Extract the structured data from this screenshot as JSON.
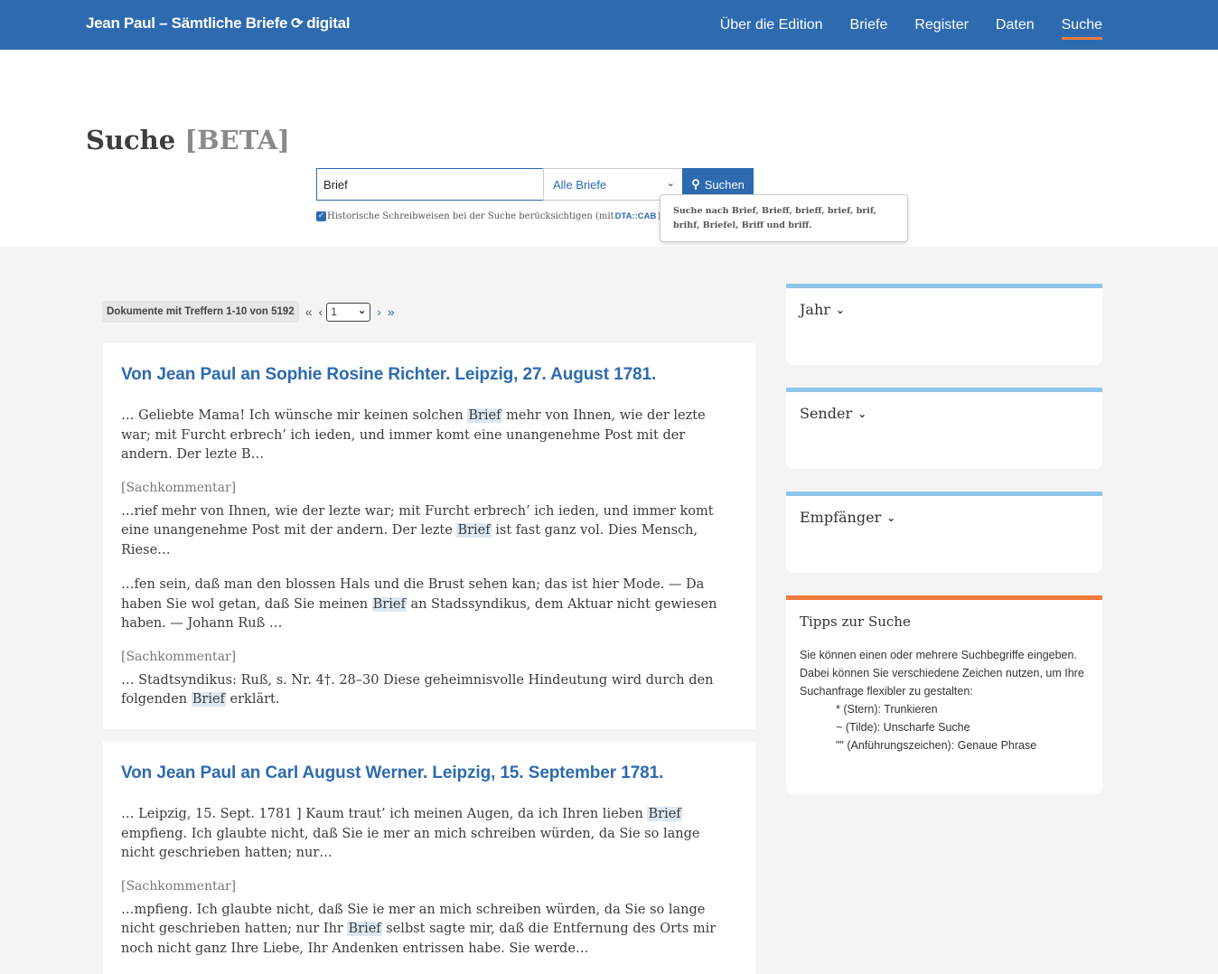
{
  "header": {
    "brand_left": "Jean Paul – Sämtliche Briefe",
    "brand_right": "digital",
    "nav": [
      "Über die Edition",
      "Briefe",
      "Register",
      "Daten",
      "Suche"
    ],
    "active_nav": "Suche",
    "accent_color": "#2d6ab0",
    "active_underline_color": "#f07a3c"
  },
  "page": {
    "title": "Suche",
    "title_suffix": "[BETA]"
  },
  "search": {
    "query": "Brief",
    "scope": "Alle Briefe",
    "button_label": "Suchen",
    "historic_label": "Historische Schreibweisen bei der Suche berücksichtigen (mit ",
    "historic_link": "DTA::CAB",
    "historic_close": ")",
    "historic_checked": true,
    "tooltip": "Suche nach Brief, Brieff, brieff, brief, brif, brihf, Briefel, Briff und briff."
  },
  "pager": {
    "count_label": "Dokumente mit Treffern 1-10 von 5192",
    "current_page": "1"
  },
  "results": [
    {
      "title": "Von Jean Paul an Sophie Rosine Richter. Leipzig, 27. August 1781.",
      "blocks": [
        {
          "type": "snippet",
          "before": "… Geliebte Mama! Ich wünsche mir keinen solchen ",
          "hit": "Brief",
          "after": " mehr von Ihnen, wie der lezte war; mit Furcht erbrech’ ich ieden, und immer komt eine unangenehme Post mit der andern. Der lezte B…"
        },
        {
          "type": "kommentar",
          "label": "[Sachkommentar]"
        },
        {
          "type": "snippet",
          "before": "…rief mehr von Ihnen, wie der lezte war; mit Furcht erbrech’ ich ieden, und immer komt eine unangenehme Post mit der andern. Der lezte ",
          "hit": "Brief",
          "after": " ist fast ganz vol. Dies Mensch, Riese…"
        },
        {
          "type": "snippet",
          "before": "…fen sein, daß man den blossen Hals und die Brust sehen kan; das ist hier Mode. — Da haben Sie wol getan, daß Sie meinen ",
          "hit": "Brief",
          "after": " an Stadssyndikus, dem Aktuar nicht gewiesen haben. — Johann Ruß …"
        },
        {
          "type": "kommentar",
          "label": "[Sachkommentar]"
        },
        {
          "type": "snippet",
          "before": "… Stadtsyndikus: Ruß, s. Nr. 4†. 28–30 Diese geheimnisvolle Hindeutung wird durch den folgenden ",
          "hit": "Brief",
          "after": " erklärt."
        }
      ]
    },
    {
      "title": "Von Jean Paul an Carl August Werner. Leipzig, 15. September 1781.",
      "blocks": [
        {
          "type": "snippet",
          "before": "… Leipzig, 15. Sept. 1781 ] Kaum traut’ ich meinen Augen, da ich Ihren lieben ",
          "hit": "Brief",
          "after": " empfieng. Ich glaubte nicht, daß Sie ie mer an mich schreiben würden, da Sie so lange nicht geschrieben hatten; nur…"
        },
        {
          "type": "kommentar",
          "label": "[Sachkommentar]"
        },
        {
          "type": "snippet",
          "before": "…mpfieng. Ich glaubte nicht, daß Sie ie mer an mich schreiben würden, da Sie so lange nicht geschrieben hatten; nur Ihr ",
          "hit": "Brief",
          "after": " selbst sagte mir, daß die Entfernung des Orts mir noch nicht ganz Ihre Liebe, Ihr Andenken entrissen habe. Sie werde…"
        }
      ]
    }
  ],
  "facets": {
    "jahr": "Jahr",
    "sender": "Sender",
    "empfaenger": "Empfänger",
    "facet_color": "#8fc5ea"
  },
  "tips": {
    "title": "Tipps zur Suche",
    "intro": "Sie können einen oder mehrere Suchbegriffe eingeben. Dabei können Sie verschiedene Zeichen nutzen, um Ihre Suchanfrage flexibler zu gestalten:",
    "items": [
      "* (Stern): Trunkieren",
      "~ (Tilde): Unscharfe Suche",
      "\"\" (Anführungszeichen): Genaue Phrase"
    ],
    "accent_color": "#f07a3c"
  }
}
